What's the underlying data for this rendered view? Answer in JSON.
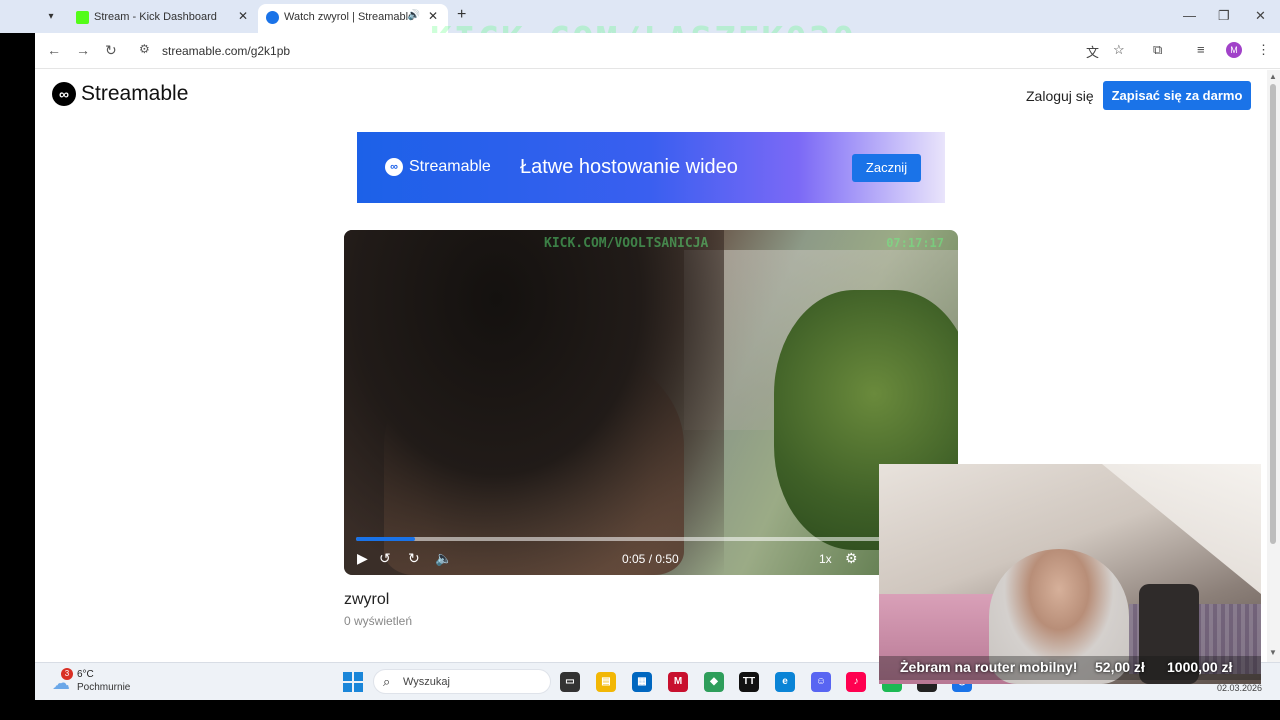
{
  "browser": {
    "tabs": [
      {
        "title": "Stream - Kick Dashboard",
        "favicon": "kick-icon",
        "color": "#53fc18"
      },
      {
        "title": "Watch zwyrol | Streamable",
        "favicon": "streamable-icon",
        "color": "#1a73e8",
        "active": true
      }
    ],
    "url": "streamable.com/g2k1pb",
    "profile_initial": "M",
    "overlay_watermark": "KICK.COM/LASZEK030"
  },
  "site": {
    "logo_text": "Streamable",
    "login_label": "Zaloguj się",
    "signup_label": "Zapisać się za darmo",
    "banner": {
      "logo_text": "Streamable",
      "headline": "Łatwe hostowanie wideo",
      "cta": "Zacznij"
    }
  },
  "video": {
    "watermark": "KICK.COM/VOOLTSANICJA",
    "corner_time": "07:17:17",
    "timecode": "0:05 / 0:50",
    "progress": 0.1,
    "speed": "1x",
    "title": "zwyrol",
    "views": "0 wyświetleń"
  },
  "taskbar": {
    "weather_badge": "3",
    "temperature": "6°C",
    "weather": "Pochmurnie",
    "search_placeholder": "Wyszukaj",
    "date": "02.03.2026"
  },
  "stream_overlay": {
    "message": "Żebram na router mobilny!",
    "amount_current": "52,00 zł",
    "amount_goal": "1000,00 zł"
  },
  "colors": {
    "accent": "#1a73e8",
    "tabbar": "#dfe7f5"
  }
}
